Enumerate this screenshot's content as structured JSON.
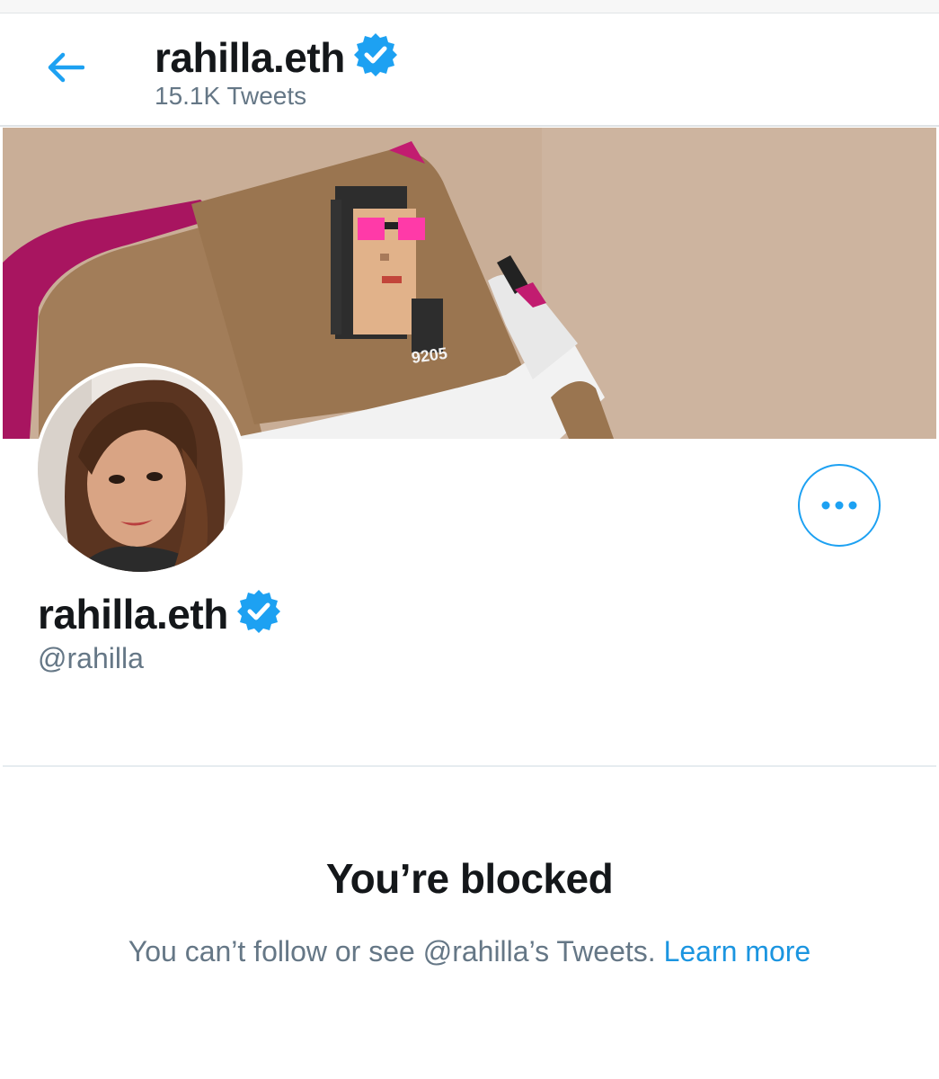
{
  "header": {
    "back_icon": "arrow-left-icon",
    "name": "rahilla.eth",
    "tweet_count": "15.1K Tweets"
  },
  "banner": {
    "overlay_number": "9205"
  },
  "profile": {
    "name": "rahilla.eth",
    "handle": "@rahilla",
    "verified_icon": "verified-badge-icon",
    "more_icon": "more-horizontal-icon"
  },
  "blocked": {
    "title": "You’re blocked",
    "description": "You can’t follow or see @rahilla’s Tweets. ",
    "learn_more": "Learn more"
  },
  "colors": {
    "accent": "#1da1f2",
    "link": "#1b95e0",
    "text_primary": "#14171a",
    "text_secondary": "#657786"
  }
}
